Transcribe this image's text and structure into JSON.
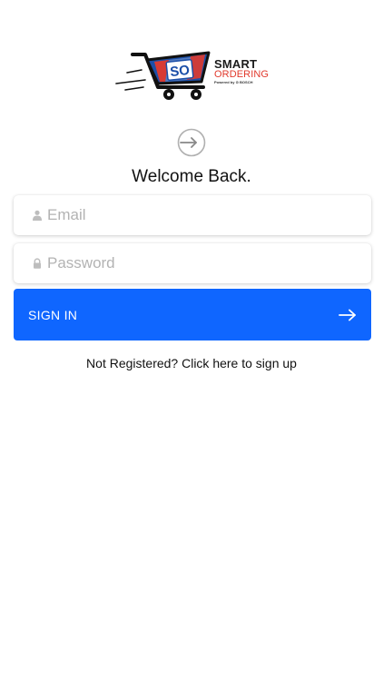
{
  "logo": {
    "badge": "SO",
    "title": "SMART",
    "subtitle": "ORDERING",
    "powered_by": "Powered by ⊙ BOSCH"
  },
  "heading": "Welcome Back.",
  "email": {
    "placeholder": "Email",
    "value": "",
    "icon": "person-icon"
  },
  "password": {
    "placeholder": "Password",
    "value": "",
    "icon": "lock-icon"
  },
  "signin": {
    "label": "SIGN IN",
    "icon": "arrow-right-icon"
  },
  "register": {
    "label": "Not Registered? Click here to sign up"
  },
  "colors": {
    "primary": "#0f66ff",
    "logo_accent": "#e13a2d",
    "placeholder": "#b3b3b3"
  }
}
